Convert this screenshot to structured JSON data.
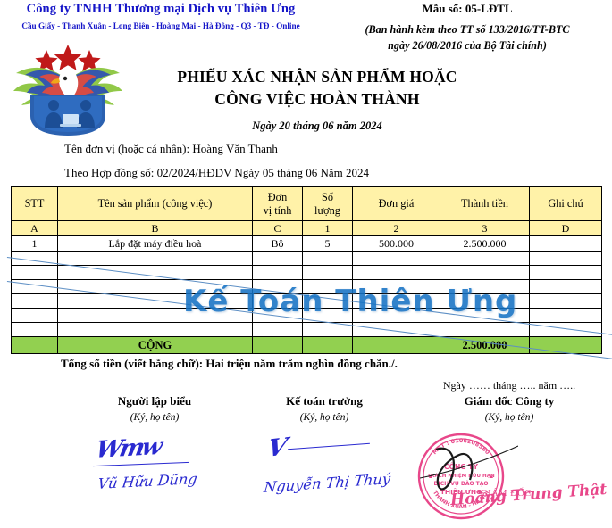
{
  "header": {
    "company_name": "Công ty TNHH Thương mại Dịch vụ Thiên Ưng",
    "company_branches": "Cầu Giấy - Thanh Xuân - Long Biên - Hoàng Mai - Hà Đông - Q3 - TĐ - Online",
    "form_code": "Mẫu số: 05-LĐTL",
    "form_issue_line1": "(Ban hành kèm theo TT số 133/2016/TT-BTC",
    "form_issue_line2": "ngày 26/08/2016 của Bộ Tài chính)",
    "logo_name": "thien-ung-eagle-shield-logo",
    "company_name_color": "#1414c8"
  },
  "title": {
    "line1": "PHIẾU XÁC NHẬN SẢN PHẨM HOẶC",
    "line2": "CÔNG VIỆC HOÀN THÀNH",
    "date": "Ngày 20 tháng 06 năm 2024"
  },
  "info": {
    "unit_line": "Tên đơn vị (hoặc cá nhân): Hoàng Văn Thanh",
    "contract_line": "Theo Hợp đồng số: 02/2024/HĐDV Ngày 05 tháng 06 Năm 2024"
  },
  "table": {
    "header_bg": "#FFF2A8",
    "total_bg": "#92D050",
    "columns": [
      "STT",
      "Tên sản phẩm (công việc)",
      "Đơn vị tính",
      "Số lượng",
      "Đơn giá",
      "Thành tiền",
      "Ghi chú"
    ],
    "column_header_line1": [
      "STT",
      "Tên sản phẩm (công việc)",
      "Đơn",
      "Số",
      "Đơn giá",
      "Thành tiền",
      "Ghi chú"
    ],
    "column_header_line2": [
      "",
      "",
      "vị tính",
      "lượng",
      "",
      "",
      ""
    ],
    "column_codes": [
      "A",
      "B",
      "C",
      "1",
      "2",
      "3",
      "D"
    ],
    "rows": [
      {
        "stt": "1",
        "name": "Lắp đặt máy điều hoà",
        "unit": "Bộ",
        "qty": "5",
        "price": "500.000",
        "amount": "2.500.000",
        "note": ""
      }
    ],
    "empty_row_count": 6,
    "total_label": "CỘNG",
    "total_amount": "2.500.000"
  },
  "total_words": "Tổng số tiền (viết bằng chữ): Hai triệu năm trăm nghìn đồng chẵn./.",
  "signatures": {
    "date_line": "Ngày …… tháng ….. năm …..",
    "blocks": [
      {
        "role": "Người lập biểu",
        "note": "(Ký, họ tên)",
        "name": "Vũ Hữu Dũng"
      },
      {
        "role": "Kế toán trưởng",
        "note": "(Ký, họ tên)",
        "name": "Nguyễn Thị Thuý"
      },
      {
        "role": "Giám đốc Công ty",
        "note": "(Ký, họ tên)",
        "name": "Hoàng Trung Thật"
      }
    ],
    "ink_color": "#2A2AD0"
  },
  "stamp": {
    "tax_code": "MST : 0106208560",
    "ring_text": "C.T.T.N.H.H D.V Đ.T - THANH XUÂN - HÀ NỘI",
    "line1": "CÔNG TY",
    "line2": "TRÁCH NHIỆM HỮU HẠN",
    "line3": "DỊCH VỤ ĐÀO TẠO",
    "line4": "THIÊN ƯNG",
    "role": "GIÁM ĐỐC",
    "signature_name": "Hoàng Trung Thật",
    "color": "#E8478A"
  },
  "watermark": {
    "text": "Kế Toán Thiên Ưng",
    "color": "#1673C4"
  }
}
